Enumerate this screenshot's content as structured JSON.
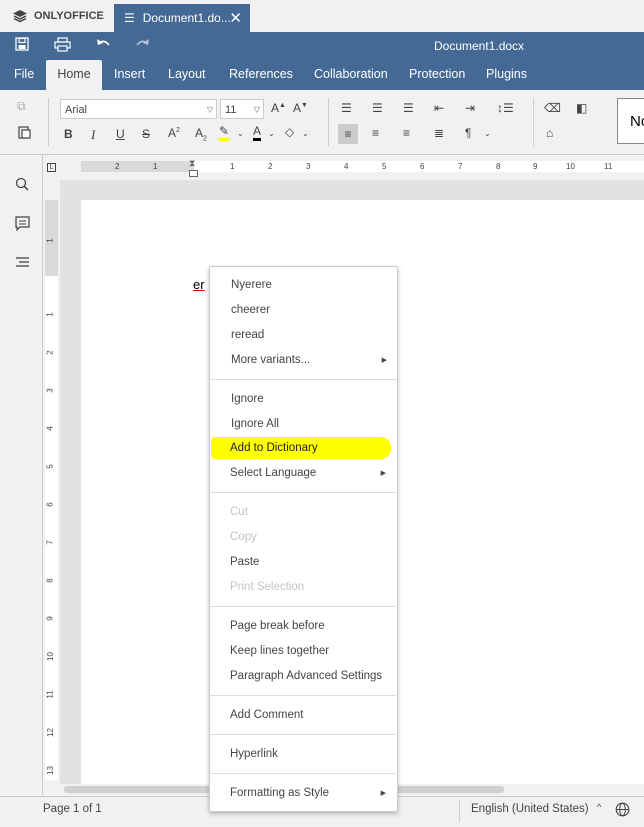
{
  "app": {
    "brand": "ONLYOFFICE",
    "tab_title": "Document1.do...",
    "doc_title": "Document1.docx",
    "accent": "#446995",
    "highlight": "#ffff00"
  },
  "menu_tabs": [
    "File",
    "Home",
    "Insert",
    "Layout",
    "References",
    "Collaboration",
    "Protection",
    "Plugins"
  ],
  "toolbar": {
    "font_name": "Arial",
    "font_size": "11",
    "style_preview": "No"
  },
  "ruler": {
    "h_numbers": [
      "2",
      "1",
      "1",
      "2",
      "3",
      "4",
      "5",
      "6",
      "7",
      "8",
      "9",
      "10",
      "11"
    ],
    "v_numbers": [
      "1",
      "1",
      "2",
      "3",
      "4",
      "5",
      "6",
      "7",
      "8",
      "9",
      "10",
      "11",
      "12",
      "13"
    ]
  },
  "document": {
    "word": "er"
  },
  "context_menu": {
    "suggestions": [
      "Nyerere",
      "cheerer",
      "reread"
    ],
    "more_variants": "More variants...",
    "ignore": "Ignore",
    "ignore_all": "Ignore All",
    "add_to_dictionary": "Add to Dictionary",
    "select_language": "Select Language",
    "cut": "Cut",
    "copy": "Copy",
    "paste": "Paste",
    "print_selection": "Print Selection",
    "page_break_before": "Page break before",
    "keep_lines_together": "Keep lines together",
    "paragraph_advanced_settings": "Paragraph Advanced Settings",
    "add_comment": "Add Comment",
    "hyperlink": "Hyperlink",
    "formatting_as_style": "Formatting as Style"
  },
  "status": {
    "page": "Page 1 of 1",
    "language": "English (United States)"
  }
}
